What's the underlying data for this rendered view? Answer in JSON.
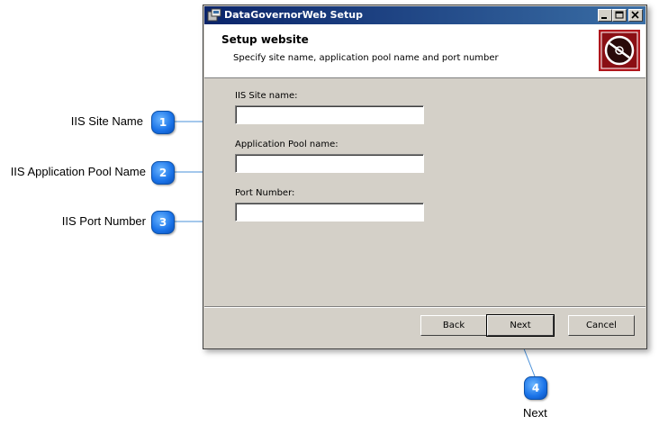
{
  "window": {
    "title": "DataGovernorWeb Setup",
    "header_title": "Setup website",
    "header_subtitle": "Specify site name, application pool name and port number"
  },
  "fields": [
    {
      "label": "IIS Site name:",
      "value": ""
    },
    {
      "label": "Application Pool name:",
      "value": ""
    },
    {
      "label": "Port Number:",
      "value": ""
    }
  ],
  "buttons": {
    "back": "Back",
    "next": "Next",
    "cancel": "Cancel"
  },
  "callouts": [
    {
      "number": "1",
      "label": "IIS Site Name"
    },
    {
      "number": "2",
      "label": "IIS Application Pool Name"
    },
    {
      "number": "3",
      "label": "IIS Port Number"
    },
    {
      "number": "4",
      "label": "Next"
    }
  ],
  "colors": {
    "titlebar_start": "#0a246a",
    "titlebar_end": "#3a6ea5",
    "dialog_face": "#d4d0c8",
    "callout_blue": "#1a73e8",
    "logo_red": "#b0161c"
  },
  "icons": {
    "app": "installer-icon",
    "logo": "no-entry-disc-icon"
  }
}
